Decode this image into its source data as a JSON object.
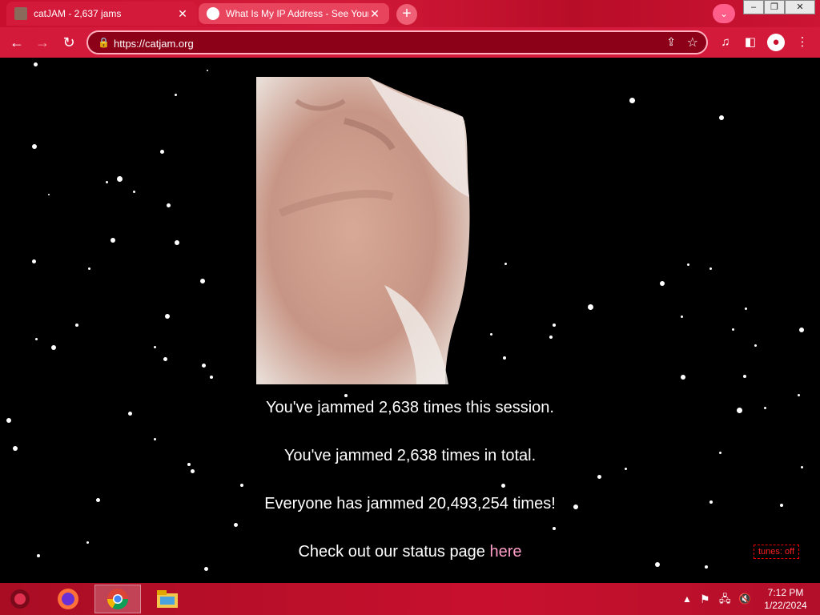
{
  "tabs": [
    {
      "title": "catJAM - 2,637 jams",
      "active": true
    },
    {
      "title": "What Is My IP Address - See Your",
      "active": false
    }
  ],
  "address": {
    "url": "https://catjam.org"
  },
  "page": {
    "session_text": "You've jammed 2,638 times this session.",
    "total_text": "You've jammed 2,638 times in total.",
    "everyone_text": "Everyone has jammed 20,493,254 times!",
    "status_prefix": "Check out our status page ",
    "status_link": "here",
    "tunes_label": "tunes: off"
  },
  "taskbar": {
    "time": "7:12 PM",
    "date": "1/22/2024"
  },
  "colors": {
    "brand": "#c8102e",
    "link": "#ff9ec8",
    "tunes": "#ff2020"
  }
}
